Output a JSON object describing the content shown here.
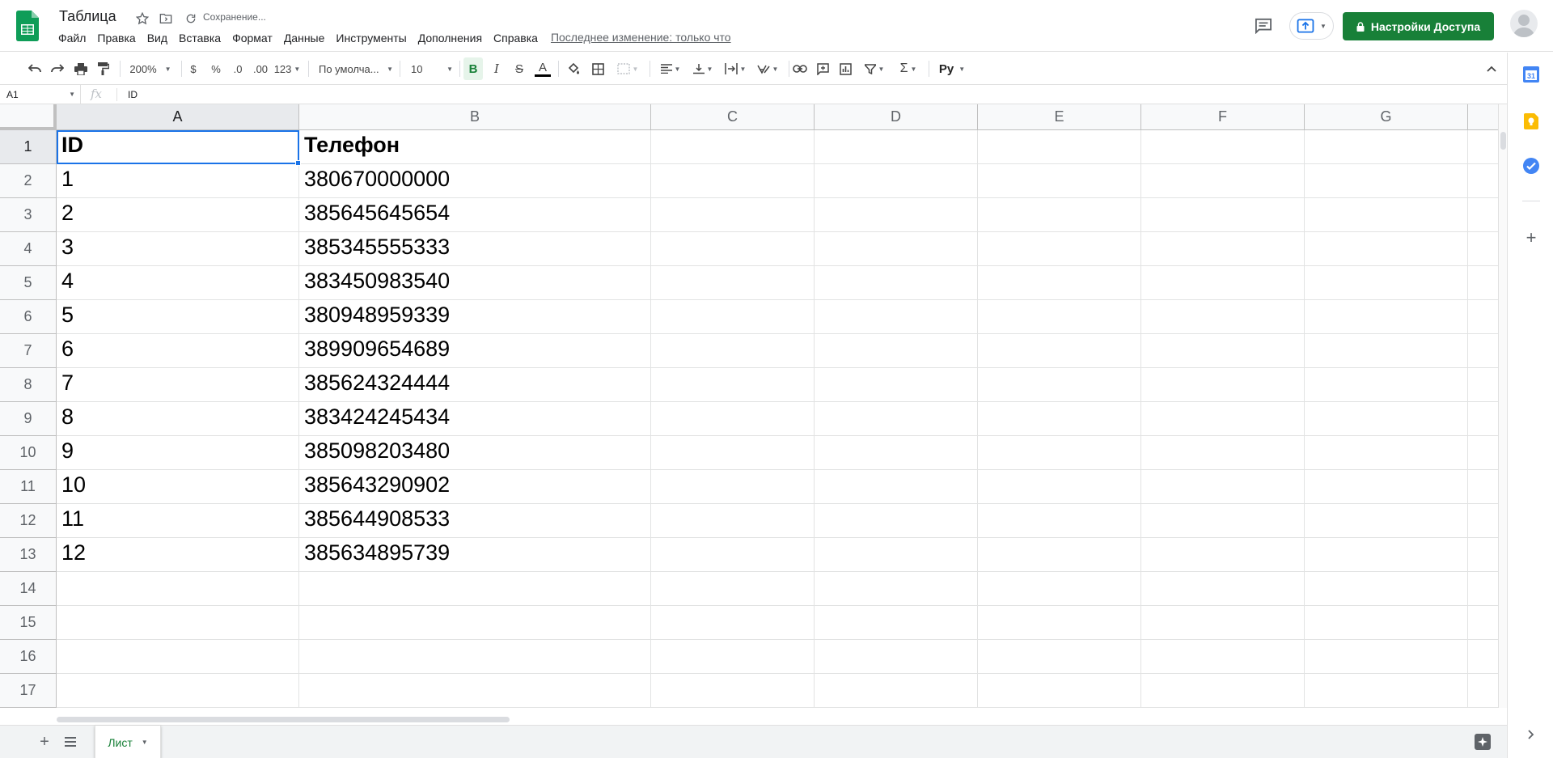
{
  "app": {
    "doc_title": "Таблица",
    "save_status": "Сохранение...",
    "brand_color": "#0f9d58"
  },
  "menu": {
    "items": [
      "Файл",
      "Правка",
      "Вид",
      "Вставка",
      "Формат",
      "Данные",
      "Инструменты",
      "Дополнения",
      "Справка"
    ],
    "last_edit": "Последнее изменение: только что"
  },
  "header": {
    "share_label": "Настройки Доступа",
    "share_color": "#188038"
  },
  "toolbar": {
    "zoom": "200%",
    "currency": "$",
    "percent": "%",
    "decrease_decimals": ".0",
    "increase_decimals": ".00",
    "more_formats": "123",
    "font": "По умолча...",
    "font_size": "10",
    "bold": "B",
    "italic": "I",
    "strikethrough": "S",
    "text_color": "A",
    "sum": "Σ",
    "input_tools": "Pу"
  },
  "formula_bar": {
    "name_box": "A1",
    "fx": "fx",
    "content": "ID"
  },
  "sheet": {
    "columns": [
      "A",
      "B",
      "C",
      "D",
      "E",
      "F",
      "G"
    ],
    "rows": [
      "1",
      "2",
      "3",
      "4",
      "5",
      "6",
      "7",
      "8",
      "9",
      "10",
      "11",
      "12",
      "13",
      "14",
      "15",
      "16",
      "17"
    ],
    "cells": [
      [
        "ID",
        "Телефон"
      ],
      [
        "1",
        "380670000000"
      ],
      [
        "2",
        "385645645654"
      ],
      [
        "3",
        "385345555333"
      ],
      [
        "4",
        "383450983540"
      ],
      [
        "5",
        "380948959339"
      ],
      [
        "6",
        "389909654689"
      ],
      [
        "7",
        "385624324444"
      ],
      [
        "8",
        "383424245434"
      ],
      [
        "9",
        "385098203480"
      ],
      [
        "10",
        "385643290902"
      ],
      [
        "11",
        "385644908533"
      ],
      [
        "12",
        "385634895739"
      ]
    ],
    "selected_cell": "A1"
  },
  "bottom": {
    "sheet_tab": "Лист"
  },
  "side_panel": {
    "icons": [
      "calendar-icon",
      "keep-icon",
      "tasks-icon",
      "add-addon-icon"
    ],
    "calendar_day": "31"
  }
}
